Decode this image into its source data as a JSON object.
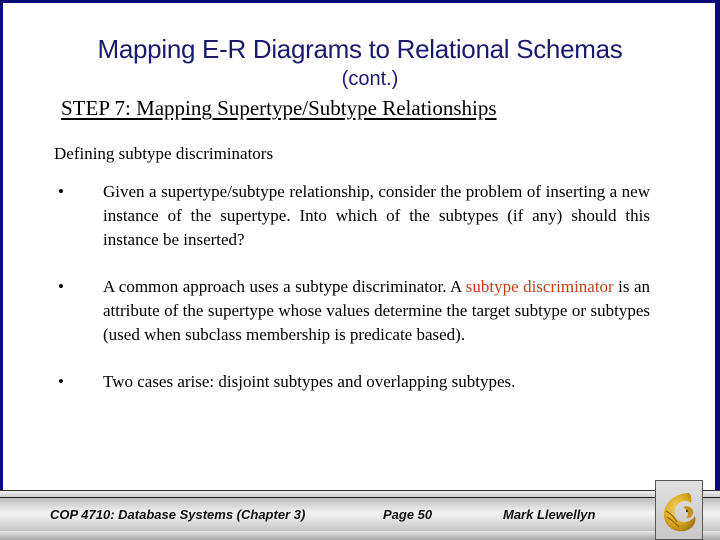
{
  "slide": {
    "title": "Mapping E-R Diagrams to Relational Schemas",
    "subtitle": "(cont.)",
    "step_heading": "STEP 7:  Mapping Supertype/Subtype Relationships",
    "section_label": "Defining subtype discriminators",
    "bullets": [
      {
        "marker": "•",
        "text": "Given a supertype/subtype relationship, consider the problem of inserting a new instance of the supertype.  Into which of the subtypes (if any) should this instance be inserted?"
      },
      {
        "marker": "•",
        "text_before": "A common approach uses a subtype discriminator.  A ",
        "highlight": "subtype discriminator",
        "text_after": " is an attribute of the supertype whose values determine the target subtype or subtypes (used when subclass membership is predicate based)."
      },
      {
        "marker": "•",
        "text": "Two cases arise: disjoint subtypes and overlapping subtypes."
      }
    ],
    "highlight_color": "#c0401a",
    "title_color": "#1a1a6e",
    "border_color": "#0a0a78"
  },
  "footer": {
    "course": "COP 4710: Database Systems  (Chapter 3)",
    "page": "Page 50",
    "author": "Mark Llewellyn",
    "logo_icon": "ucf-pegasus-logo-icon"
  }
}
